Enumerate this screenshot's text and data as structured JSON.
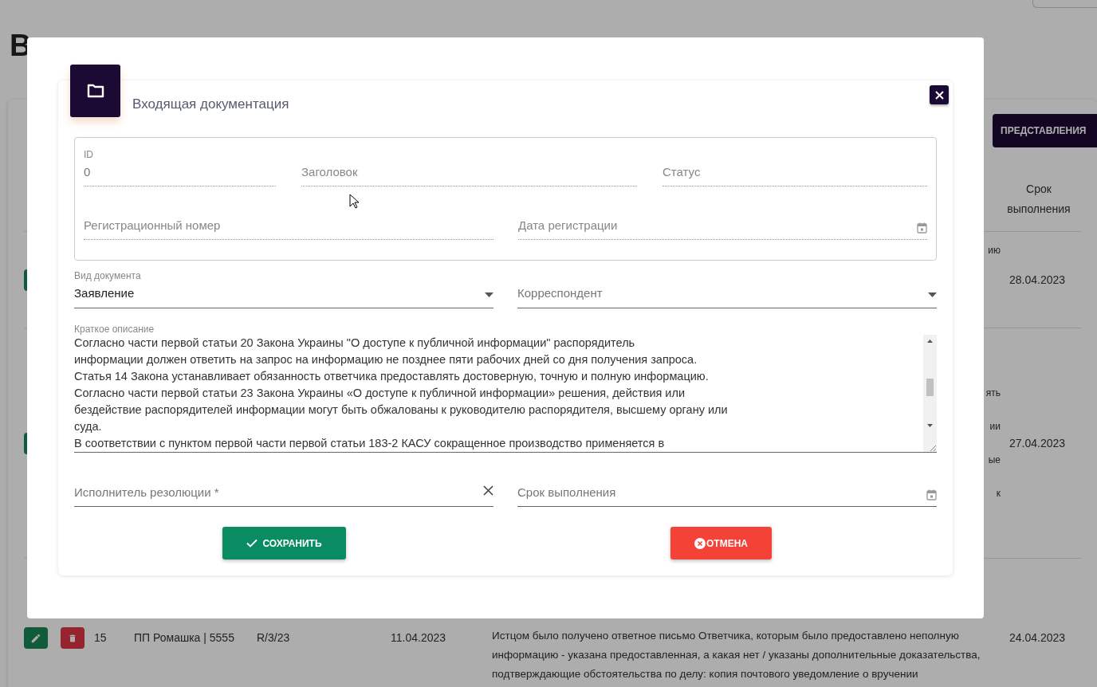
{
  "page": {
    "title": "В",
    "views_button": "ПРЕДСТАВЛЕНИЯ",
    "table": {
      "deadline_header": "Срок выполнения",
      "rows": [
        {
          "actions": [
            {
              "kind": "edit"
            }
          ],
          "description_lines": [
            "ию"
          ],
          "deadline": "28.04.2023"
        },
        {
          "actions": [
            {
              "kind": "edit"
            }
          ],
          "description_lines": [
            "ять",
            "ии",
            "ые",
            "к"
          ],
          "deadline": "27.04.2023"
        },
        {
          "actions": [
            {
              "kind": "edit"
            },
            {
              "kind": "delete"
            }
          ],
          "number": "15",
          "correspondent": "ПП Ромашка | 5555",
          "reg_number": "R/3/23",
          "reg_date": "11.04.2023",
          "description_lines": [
            "Истцом было получено ответное письмо Ответчика, которым было предоставлено неполную",
            "информацию - указана предоставленная, а какая нет / указаны дополнительные доказательства,",
            "подтверждающие обстоятельства по делу: копия почтового уведомление о вручении"
          ],
          "deadline": "24.04.2023"
        }
      ]
    }
  },
  "dialog": {
    "title": "Входящая документация",
    "registration_box": [
      {
        "label": "ID",
        "value": "0"
      },
      {
        "placeholder": "Заголовок"
      },
      {
        "placeholder": "Статус"
      },
      {
        "placeholder": "Регистрационный номер"
      },
      {
        "placeholder": "Дата регистрации",
        "kind": "date"
      }
    ],
    "selects": [
      {
        "label": "Вид документа",
        "value": "Заявление"
      },
      {
        "placeholder": "Корреспондент"
      }
    ],
    "description": {
      "label": "Краткое описание",
      "lines": [
        "Согласно части первой статьи 20 Закона Украины \"О доступе к публичной информации\" распорядитель",
        "информации должен ответить на запрос на информацию не позднее пяти рабочих дней со дня получения запроса.",
        "Статья 14 Закона устанавливает обязанность ответчика предоставлять достоверную, точную и полную информацию.",
        "Согласно части первой статьи 23 Закона Украины «О доступе к публичной информации» решения, действия или",
        "бездействие распорядителей информации могут быть обжалованы к руководителю распорядителя, высшему органу или",
        "суда.",
        "В соответствии с пунктом первой части первой статьи 183-2 КАСУ сокращенное производство применяется в"
      ]
    },
    "bottom_fields": [
      {
        "placeholder": "Исполнитель резолюции *",
        "clearable": true
      },
      {
        "placeholder": "Срок выполнения",
        "kind": "date"
      }
    ],
    "buttons": [
      {
        "label": "СОХРАНИТЬ",
        "kind": "save"
      },
      {
        "label": "ОТМЕНА",
        "kind": "cancel"
      }
    ]
  }
}
